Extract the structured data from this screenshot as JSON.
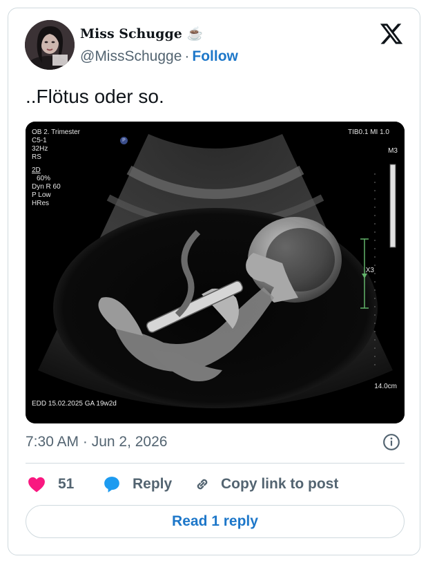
{
  "author": {
    "display_name": "Miss Schugge",
    "display_suffix": "☕",
    "handle": "@MissSchugge",
    "separator": "·",
    "follow_label": "Follow"
  },
  "tweet": {
    "text": "..Flötus oder so."
  },
  "media": {
    "overlay_left": {
      "line1": "OB 2. Trimester",
      "line2": "C5-1",
      "line3": "32Hz",
      "line4": "RS",
      "line5": "2D",
      "line6": "60%",
      "line7": "Dyn R 60",
      "line8": "P Low",
      "line9": "HRes"
    },
    "probe_marker": "P",
    "overlay_top_right": "TIB0.1   MI 1.0",
    "overlay_m3": "M3",
    "overlay_x3": "X3",
    "depth": "14.0cm",
    "edd": "EDD 15.02.2025   GA 19w2d"
  },
  "meta": {
    "timestamp": "7:30 AM · Jun 2, 2026"
  },
  "actions": {
    "like_count": "51",
    "reply_label": "Reply",
    "copy_label": "Copy link to post"
  },
  "read_replies_label": "Read 1 reply",
  "colors": {
    "accent": "#1d77c9",
    "like": "#f91880",
    "reply_icon": "#1d9bf0",
    "muted": "#536471",
    "border": "#cfd9de"
  },
  "icons": {
    "brand": "x-logo-icon",
    "like": "heart-icon",
    "reply": "speech-bubble-icon",
    "copy": "link-icon",
    "info": "info-icon"
  }
}
